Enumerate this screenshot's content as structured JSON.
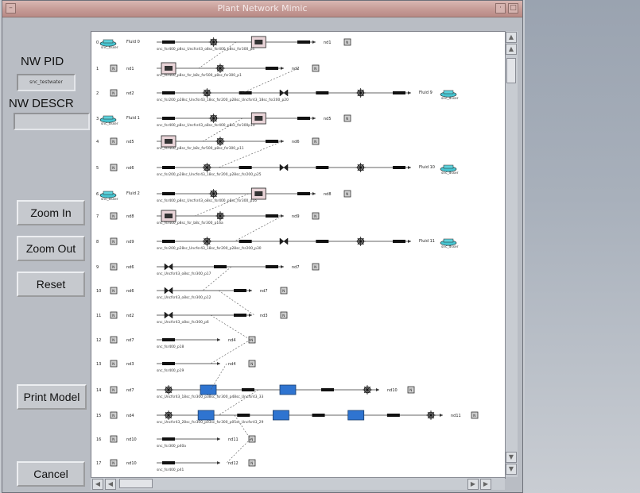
{
  "window": {
    "title": "Plant Network Mimic"
  },
  "left_panel": {
    "nw_pid_label": "NW PID",
    "nw_pid_value": "snc_testwater",
    "nw_descr_label": "NW DESCR",
    "nw_descr_value": "",
    "buttons": {
      "zoom_in": "Zoom In",
      "zoom_out": "Zoom Out",
      "reset": "Reset",
      "print_model": "Print Model",
      "cancel": "Cancel"
    }
  },
  "diagram": {
    "rows": [
      {
        "num": "0",
        "start": "Fluid 0",
        "start_type": "source",
        "start_sub": "snc_dsser",
        "caption": "snc_fsr400_p8sc_Uncfsr43_o8sc_fsr400_p8sc_fsr300_p4",
        "end": "nd1",
        "end_type": "node",
        "devices": [
          "pipe",
          "pump",
          "valveblock",
          "pipe"
        ]
      },
      {
        "num": "1",
        "start": "nd1",
        "start_type": "node",
        "caption": "snc_fsr400_p8sc_fsr_b8c_fsr500_p8sc_fsr300_p1",
        "end": "nd2",
        "end_type": "node",
        "devices": [
          "valveblock",
          "pump",
          "pipe"
        ]
      },
      {
        "num": "2",
        "start": "nd2",
        "start_type": "node",
        "caption": "snc_fsr200_p28sc_Uncfsr43_18sc_fsr200_p28sc_Uncfsr43_18sc_fsr200_p20",
        "end": "Fluid 9",
        "end_type": "sink",
        "end_sub": "snc_dsser",
        "devices": [
          "pipe",
          "pump",
          "pipe",
          "valve",
          "pipe",
          "pump",
          "pipe"
        ]
      },
      {
        "num": "3",
        "start": "Fluid 1",
        "start_type": "source",
        "start_sub": "snc_dsser",
        "caption": "snc_fsr400_p8sc_Uncfsr43_o8sc_fsr400_p8sc_fsr300p10",
        "end": "nd5",
        "end_type": "node",
        "devices": [
          "pipe",
          "pump",
          "valveblock",
          "pipe"
        ]
      },
      {
        "num": "4",
        "start": "nd5",
        "start_type": "node",
        "caption": "snc_fsr400_p8sc_fsr_b8c_fsr500_p8sc_fsr300_p11",
        "end": "nd6",
        "end_type": "node",
        "devices": [
          "valveblock",
          "pump",
          "pipe"
        ]
      },
      {
        "num": "5",
        "start": "nd6",
        "start_type": "node",
        "caption": "snc_fsr200_p28sc_Uncfsr43_18sc_fsr200_p28sc_fsr200_p25",
        "end": "Fluid 10",
        "end_type": "sink",
        "end_sub": "snc_dsser",
        "devices": [
          "pipe",
          "pump",
          "pipe",
          "valve",
          "pipe",
          "pump",
          "pipe"
        ]
      },
      {
        "num": "6",
        "start": "Fluid 2",
        "start_type": "source",
        "start_sub": "snc_dsser",
        "caption": "snc_fsr400_p8sc_Uncfsr43_o8sc_fsr400_p8sc_fsr300_p16",
        "end": "nd8",
        "end_type": "node",
        "devices": [
          "pipe",
          "pump",
          "valveblock",
          "pipe"
        ]
      },
      {
        "num": "7",
        "start": "nd8",
        "start_type": "node",
        "caption": "snc_fsr400_p8sc_fsr_b8c_fsr300_p16a",
        "end": "nd9",
        "end_type": "node",
        "devices": [
          "valveblock",
          "pump",
          "pipe"
        ]
      },
      {
        "num": "8",
        "start": "nd9",
        "start_type": "node",
        "caption": "snc_fsr200_p28sc_Uncfsr43_18sc_fsr200_p28sc_fsr200_p30",
        "end": "Fluid 11",
        "end_type": "sink",
        "end_sub": "snc_dsser",
        "devices": [
          "pipe",
          "pump",
          "pipe",
          "valve",
          "pipe",
          "pump",
          "pipe"
        ]
      },
      {
        "num": "9",
        "start": "nd6",
        "start_type": "node",
        "caption": "snc_Uncfsr43_o8sc_fsr300_p17",
        "end": "nd7",
        "end_type": "node",
        "devices": [
          "valve",
          "pipe",
          "pipe"
        ]
      },
      {
        "num": "10",
        "start": "nd6",
        "start_type": "node",
        "caption": "snc_Uncfsr43_o8sc_fsr300_p12",
        "end": "nd7",
        "end_type": "node",
        "devices": [
          "valve",
          "pipe"
        ]
      },
      {
        "num": "11",
        "start": "nd2",
        "start_type": "node",
        "caption": "snc_Uncfsr43_o8sc_fsr300_p6",
        "end": "nd3",
        "end_type": "node",
        "devices": [
          "valve",
          "pipe"
        ]
      },
      {
        "num": "12",
        "start": "nd7",
        "start_type": "node",
        "caption": "snc_fsr400_p18",
        "end": "nd4",
        "end_type": "node",
        "devices": [
          "pipe"
        ]
      },
      {
        "num": "13",
        "start": "nd3",
        "start_type": "node",
        "caption": "snc_fsr400_p19",
        "end": "nd4",
        "end_type": "node",
        "devices": [
          "pipe"
        ]
      },
      {
        "num": "14",
        "start": "nd7",
        "start_type": "node",
        "caption": "snc_Uncfsr43_18sc_fsr300_p38sc_fsr300_p48sc_Uncfsr43_33",
        "end": "nd10",
        "end_type": "node",
        "devices": [
          "pump",
          "hx",
          "pipe",
          "hx",
          "pipe",
          "pump"
        ]
      },
      {
        "num": "15",
        "start": "nd4",
        "start_type": "node",
        "caption": "snc_Uncfsr43_28sc_fsr300_p03sc_fsr300_p05sc_Uncfsr43_29",
        "end": "nd11",
        "end_type": "node",
        "devices": [
          "pump",
          "hx",
          "pipe",
          "hx",
          "pipe",
          "hx",
          "pipe",
          "pump"
        ]
      },
      {
        "num": "16",
        "start": "nd10",
        "start_type": "node",
        "caption": "snc_fsr300_p40a",
        "end": "nd11",
        "end_type": "node",
        "devices": [
          "pipe"
        ]
      },
      {
        "num": "17",
        "start": "nd10",
        "start_type": "node",
        "caption": "snc_fsr400_p41",
        "end": "nd12",
        "end_type": "node",
        "devices": [
          "pipe"
        ]
      }
    ]
  }
}
